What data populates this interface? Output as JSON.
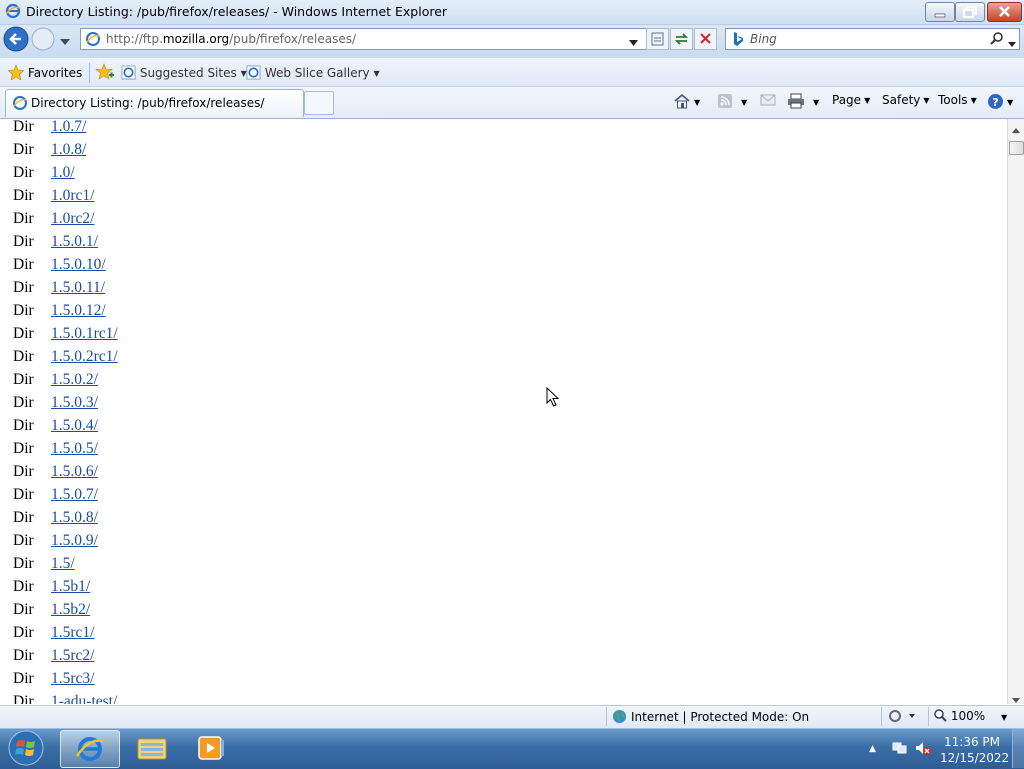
{
  "window": {
    "title": "Directory Listing: /pub/firefox/releases/ - Windows Internet Explorer"
  },
  "address": {
    "prefix": "http://ftp.",
    "domain": "mozilla.org",
    "path": "/pub/firefox/releases/"
  },
  "search": {
    "placeholder": "Bing"
  },
  "favorites_bar": {
    "favorites_label": "Favorites",
    "suggested_sites_label": "Suggested Sites",
    "web_slice_label": "Web Slice Gallery"
  },
  "tab": {
    "title": "Directory Listing: /pub/firefox/releases/"
  },
  "command_bar": {
    "page_label": "Page",
    "safety_label": "Safety",
    "tools_label": "Tools"
  },
  "listing": [
    {
      "kind": "Dir",
      "name": "1.0.7/"
    },
    {
      "kind": "Dir",
      "name": "1.0.8/"
    },
    {
      "kind": "Dir",
      "name": "1.0/"
    },
    {
      "kind": "Dir",
      "name": "1.0rc1/"
    },
    {
      "kind": "Dir",
      "name": "1.0rc2/"
    },
    {
      "kind": "Dir",
      "name": "1.5.0.1/"
    },
    {
      "kind": "Dir",
      "name": "1.5.0.10/"
    },
    {
      "kind": "Dir",
      "name": "1.5.0.11/"
    },
    {
      "kind": "Dir",
      "name": "1.5.0.12/"
    },
    {
      "kind": "Dir",
      "name": "1.5.0.1rc1/"
    },
    {
      "kind": "Dir",
      "name": "1.5.0.2rc1/"
    },
    {
      "kind": "Dir",
      "name": "1.5.0.2/"
    },
    {
      "kind": "Dir",
      "name": "1.5.0.3/"
    },
    {
      "kind": "Dir",
      "name": "1.5.0.4/"
    },
    {
      "kind": "Dir",
      "name": "1.5.0.5/"
    },
    {
      "kind": "Dir",
      "name": "1.5.0.6/"
    },
    {
      "kind": "Dir",
      "name": "1.5.0.7/"
    },
    {
      "kind": "Dir",
      "name": "1.5.0.8/"
    },
    {
      "kind": "Dir",
      "name": "1.5.0.9/"
    },
    {
      "kind": "Dir",
      "name": "1.5/"
    },
    {
      "kind": "Dir",
      "name": "1.5b1/"
    },
    {
      "kind": "Dir",
      "name": "1.5b2/"
    },
    {
      "kind": "Dir",
      "name": "1.5rc1/"
    },
    {
      "kind": "Dir",
      "name": "1.5rc2/"
    },
    {
      "kind": "Dir",
      "name": "1.5rc3/"
    },
    {
      "kind": "Dir",
      "name": "1-adu-test/"
    }
  ],
  "status_bar": {
    "zone_text": "Internet | Protected Mode: On",
    "zoom": "100%"
  },
  "taskbar": {
    "time": "11:36 PM",
    "date": "12/15/2022"
  }
}
